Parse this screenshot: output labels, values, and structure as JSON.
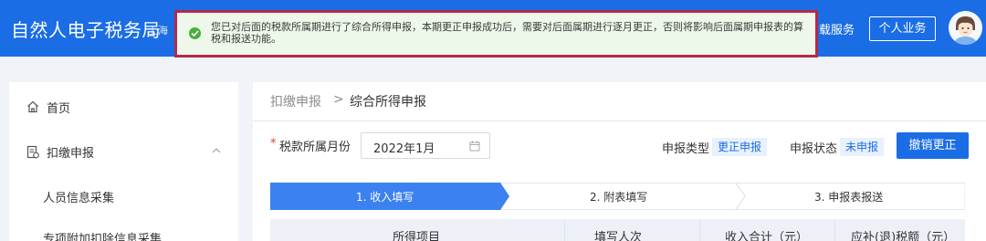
{
  "header": {
    "app_title": "自然人电子税务局",
    "region": "上海",
    "download_service": "载服务",
    "personal_business": "个人业务"
  },
  "toast": {
    "message": "您已对后面的税款所属期进行了综合所得申报，本期更正申报成功后，需要对后面属期进行逐月更正，否则将影响后面属期申报表的算税和报送功能。",
    "border_color": "#b6284a",
    "icon": "success-check-icon"
  },
  "sidebar": {
    "home": "首页",
    "withholding": "扣缴申报",
    "personnel_info": "人员信息采集",
    "special_deduction": "专项附加扣除信息采集"
  },
  "breadcrumb": {
    "parent": "扣缴申报",
    "separator": ">",
    "current": "综合所得申报"
  },
  "form": {
    "required_mark": "*",
    "period_label": "税款所属月份",
    "period_value": "2022年1月",
    "declare_type_label": "申报类型",
    "declare_type_value": "更正申报",
    "declare_status_label": "申报状态",
    "declare_status_value": "未申报",
    "revoke_button": "撤销更正"
  },
  "steps": [
    {
      "label": "1. 收入填写",
      "active": true
    },
    {
      "label": "2. 附表填写",
      "active": false
    },
    {
      "label": "3. 申报表报送",
      "active": false
    }
  ],
  "table": {
    "columns": [
      "所得项目",
      "填写人次",
      "收入合计（元）",
      "应补(退)税额（元）"
    ]
  },
  "colors": {
    "primary": "#1a6de4",
    "success": "#4cad3f",
    "toast_bg": "#edf7ea"
  }
}
